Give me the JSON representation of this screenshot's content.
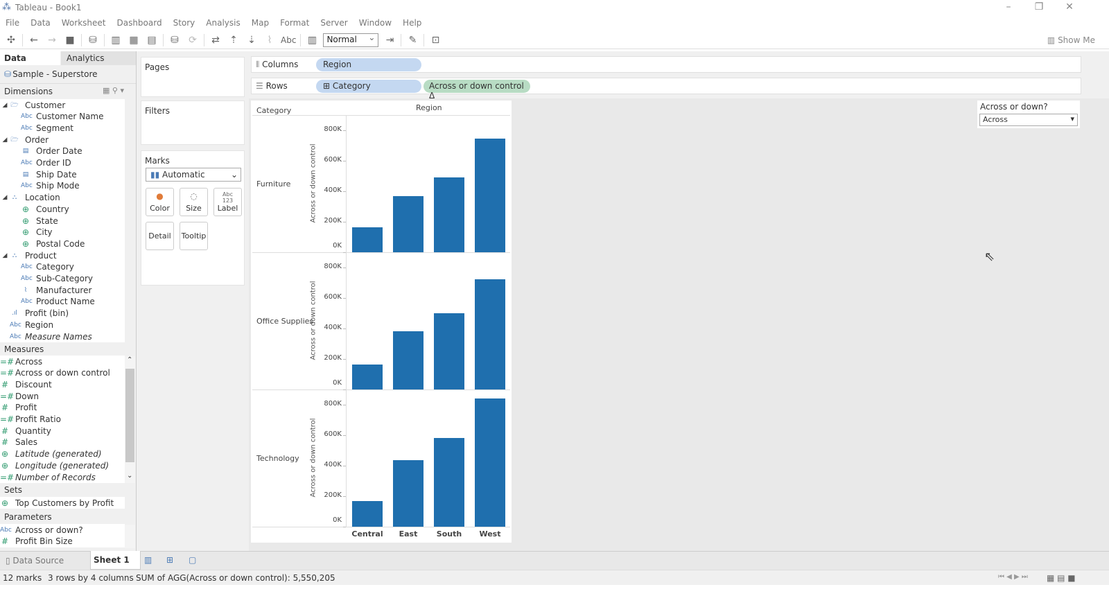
{
  "window": {
    "title": "Tableau - Book1"
  },
  "menu": [
    "File",
    "Data",
    "Worksheet",
    "Dashboard",
    "Story",
    "Analysis",
    "Map",
    "Format",
    "Server",
    "Window",
    "Help"
  ],
  "toolbar": {
    "fit_value": "Normal",
    "show_me": "Show Me",
    "abc": "Abc"
  },
  "left": {
    "tabs": {
      "data": "Data",
      "analytics": "Analytics"
    },
    "datasource": "Sample - Superstore",
    "dimensions_label": "Dimensions",
    "dimensions": [
      {
        "label": "Customer",
        "type": "folder",
        "indent": 0
      },
      {
        "label": "Customer Name",
        "type": "Abc",
        "indent": 1
      },
      {
        "label": "Segment",
        "type": "Abc",
        "indent": 1
      },
      {
        "label": "Order",
        "type": "folder",
        "indent": 0
      },
      {
        "label": "Order Date",
        "type": "date",
        "indent": 1
      },
      {
        "label": "Order ID",
        "type": "Abc",
        "indent": 1
      },
      {
        "label": "Ship Date",
        "type": "date",
        "indent": 1
      },
      {
        "label": "Ship Mode",
        "type": "Abc",
        "indent": 1
      },
      {
        "label": "Location",
        "type": "hier",
        "indent": 0
      },
      {
        "label": "Country",
        "type": "geo",
        "indent": 1
      },
      {
        "label": "State",
        "type": "geo",
        "indent": 1
      },
      {
        "label": "City",
        "type": "geo",
        "indent": 1
      },
      {
        "label": "Postal Code",
        "type": "geo",
        "indent": 1
      },
      {
        "label": "Product",
        "type": "hier",
        "indent": 0
      },
      {
        "label": "Category",
        "type": "Abc",
        "indent": 1
      },
      {
        "label": "Sub-Category",
        "type": "Abc",
        "indent": 1
      },
      {
        "label": "Manufacturer",
        "type": "clip",
        "indent": 1
      },
      {
        "label": "Product Name",
        "type": "Abc",
        "indent": 1
      },
      {
        "label": "Profit (bin)",
        "type": "bin",
        "indent": 0
      },
      {
        "label": "Region",
        "type": "Abc",
        "indent": 0
      },
      {
        "label": "Measure Names",
        "type": "Abc",
        "indent": 0,
        "italic": true
      }
    ],
    "measures_label": "Measures",
    "measures": [
      {
        "label": "Across",
        "type": "=#"
      },
      {
        "label": "Across or down control",
        "type": "=#"
      },
      {
        "label": "Discount",
        "type": "#"
      },
      {
        "label": "Down",
        "type": "=#"
      },
      {
        "label": "Profit",
        "type": "#"
      },
      {
        "label": "Profit Ratio",
        "type": "=#"
      },
      {
        "label": "Quantity",
        "type": "#"
      },
      {
        "label": "Sales",
        "type": "#"
      },
      {
        "label": "Latitude (generated)",
        "type": "geo",
        "italic": true
      },
      {
        "label": "Longitude (generated)",
        "type": "geo",
        "italic": true
      },
      {
        "label": "Number of Records",
        "type": "=#",
        "italic": true
      }
    ],
    "sets_label": "Sets",
    "sets": [
      {
        "label": "Top Customers by Profit"
      }
    ],
    "parameters_label": "Parameters",
    "parameters": [
      {
        "label": "Across or down?",
        "type": "Abc"
      },
      {
        "label": "Profit Bin Size",
        "type": "#"
      }
    ]
  },
  "cards": {
    "pages": "Pages",
    "filters": "Filters",
    "marks": "Marks",
    "mark_type": "Automatic",
    "buttons": {
      "color": "Color",
      "size": "Size",
      "label": "Label",
      "detail": "Detail",
      "tooltip": "Tooltip"
    }
  },
  "shelves": {
    "columns_label": "Columns",
    "rows_label": "Rows",
    "columns": [
      "Region"
    ],
    "rows": [
      "Category",
      "Across or down control Δ"
    ]
  },
  "parameter_control": {
    "title": "Across or down?",
    "value": "Across"
  },
  "chart_data": {
    "type": "bar",
    "row_header_title": "Category",
    "column_header_title": "Region",
    "categories": [
      "Central",
      "East",
      "South",
      "West"
    ],
    "rows": [
      {
        "name": "Furniture",
        "values": [
          163000,
          370000,
          490000,
          745000
        ]
      },
      {
        "name": "Office Supplies",
        "values": [
          163000,
          383000,
          500000,
          722000
        ]
      },
      {
        "name": "Technology",
        "values": [
          170000,
          437000,
          584000,
          840000
        ]
      }
    ],
    "ylabel": "Across or down control",
    "yticks": [
      "0K",
      "200K",
      "400K",
      "600K",
      "800K"
    ],
    "ylim": [
      0,
      800000
    ],
    "bar_color": "#1f6fae"
  },
  "bottom": {
    "data_source": "Data Source",
    "sheet": "Sheet 1"
  },
  "status": {
    "marks": "12 marks",
    "dims": "3 rows by 4 columns",
    "sum": "SUM of AGG(Across or down control): 5,550,205"
  }
}
